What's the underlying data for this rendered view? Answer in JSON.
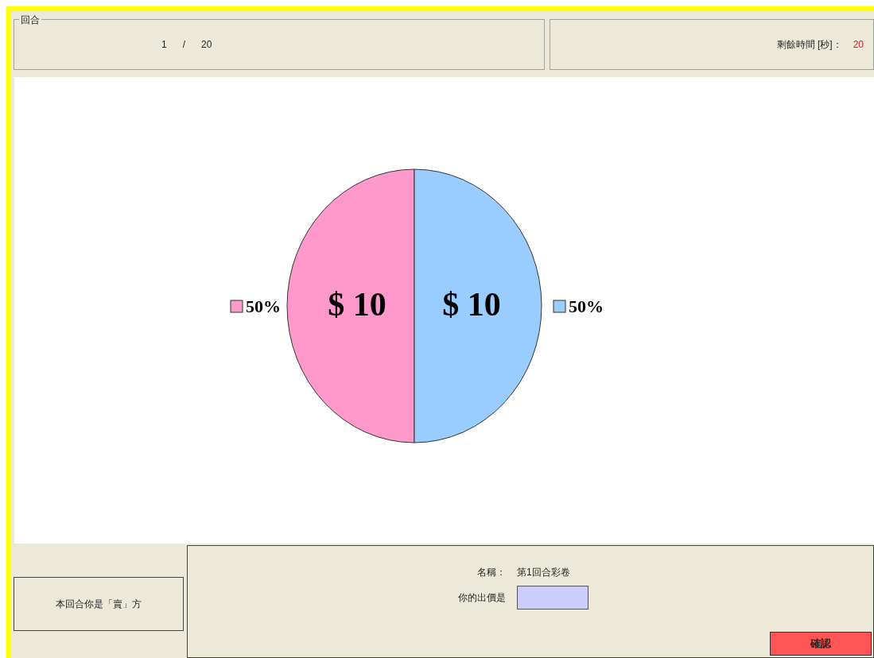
{
  "round_group": {
    "title": "回合",
    "current": "1",
    "separator": "/",
    "total": "20"
  },
  "timer": {
    "label": "剩餘時間 [秒]：",
    "value": "20"
  },
  "lottery": {
    "chart_data": {
      "type": "pie",
      "categories": [
        "$ 10",
        "$ 10"
      ],
      "values": [
        50,
        50
      ]
    },
    "legend": [
      {
        "color": "#ff99cc",
        "label": "50%"
      },
      {
        "color": "#99ccff",
        "label": "50%"
      }
    ]
  },
  "role": {
    "text": "本回合你是「賣」方"
  },
  "bid": {
    "name_label": "名稱：",
    "name_value": "第1回合彩卷",
    "price_label": "你的出價是",
    "confirm": "確認"
  }
}
